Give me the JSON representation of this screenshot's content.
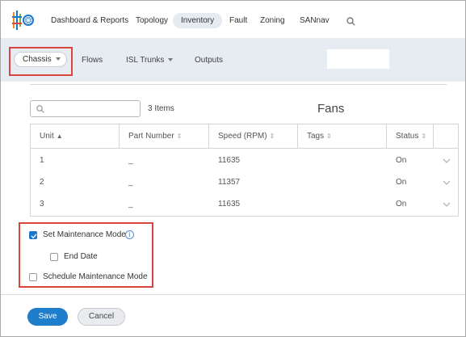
{
  "topnav": {
    "items": [
      {
        "label": "Dashboard & Reports"
      },
      {
        "label": "Topology"
      },
      {
        "label": "Inventory",
        "active": true
      },
      {
        "label": "Fault"
      },
      {
        "label": "Zoning"
      },
      {
        "label": "SANnav"
      }
    ],
    "search_icon": "search-icon"
  },
  "subnav": {
    "chassis": "Chassis",
    "flows": "Flows",
    "isl_trunks": "ISL Trunks",
    "outputs": "Outputs"
  },
  "toolbar": {
    "search_placeholder": "",
    "items_count": "3 Items",
    "section_title": "Fans"
  },
  "table": {
    "columns": [
      "Unit",
      "Part Number",
      "Speed (RPM)",
      "Tags",
      "Status"
    ],
    "rows": [
      {
        "unit": "1",
        "part": "_",
        "speed": "11635",
        "tags": "",
        "status": "On"
      },
      {
        "unit": "2",
        "part": "_",
        "speed": "11357",
        "tags": "",
        "status": "On"
      },
      {
        "unit": "3",
        "part": "_",
        "speed": "11635",
        "tags": "",
        "status": "On"
      }
    ]
  },
  "maintenance": {
    "set_mode": "Set Maintenance Mode",
    "set_mode_checked": true,
    "end_date": "End Date",
    "end_date_checked": false,
    "schedule": "Schedule Maintenance Mode",
    "schedule_checked": false
  },
  "footer": {
    "save": "Save",
    "cancel": "Cancel"
  },
  "colors": {
    "accent": "#1f7ecb",
    "highlight": "#d9453d",
    "subnav_bg": "#e7ebf2"
  }
}
